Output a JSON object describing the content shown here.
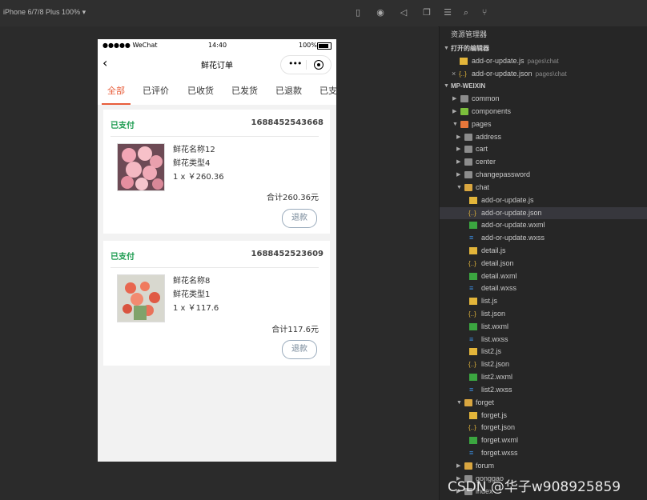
{
  "toolbar": {
    "device_select": "iPhone 6/7/8 Plus 100% ▾",
    "icons": [
      "phone-icon",
      "record-icon",
      "send-icon",
      "window-icon",
      "list-icon",
      "search-icon",
      "branch-icon"
    ]
  },
  "phone": {
    "statusbar": {
      "carrier": "●●●●● WeChat",
      "time": "14:40",
      "battery": "100%"
    },
    "navbar": {
      "title": "鲜花订单"
    },
    "tabs": [
      "全部",
      "已评价",
      "已收货",
      "已发货",
      "已退款",
      "已支"
    ],
    "orders": [
      {
        "status": "已支付",
        "order_no": "1688452543668",
        "name": "鲜花名称12",
        "type": "鲜花类型4",
        "qty_price": "1 x ￥260.36",
        "total": "合计260.36元",
        "button": "退款"
      },
      {
        "status": "已支付",
        "order_no": "1688452523609",
        "name": "鲜花名称8",
        "type": "鲜花类型1",
        "qty_price": "1 x ￥117.6",
        "total": "合计117.6元",
        "button": "退款"
      }
    ]
  },
  "explorer": {
    "title": "资源管理器",
    "open_editors_header": "打开的编辑器",
    "project_header": "MP-WEIXIN",
    "open_editors": [
      {
        "name": "add-or-update.js",
        "path": "pages\\chat"
      },
      {
        "name": "add-or-update.json",
        "path": "pages\\chat"
      }
    ],
    "tree": [
      "common",
      "components",
      "pages",
      "address",
      "cart",
      "center",
      "changepassword",
      "chat",
      "add-or-update.js",
      "add-or-update.json",
      "add-or-update.wxml",
      "add-or-update.wxss",
      "detail.js",
      "detail.json",
      "detail.wxml",
      "detail.wxss",
      "list.js",
      "list.json",
      "list.wxml",
      "list.wxss",
      "list2.js",
      "list2.json",
      "list2.wxml",
      "list2.wxss",
      "forget",
      "forget.js",
      "forget.json",
      "forget.wxml",
      "forget.wxss",
      "forum",
      "gonggao",
      "index"
    ]
  },
  "watermark": "CSDN @华子w908925859"
}
